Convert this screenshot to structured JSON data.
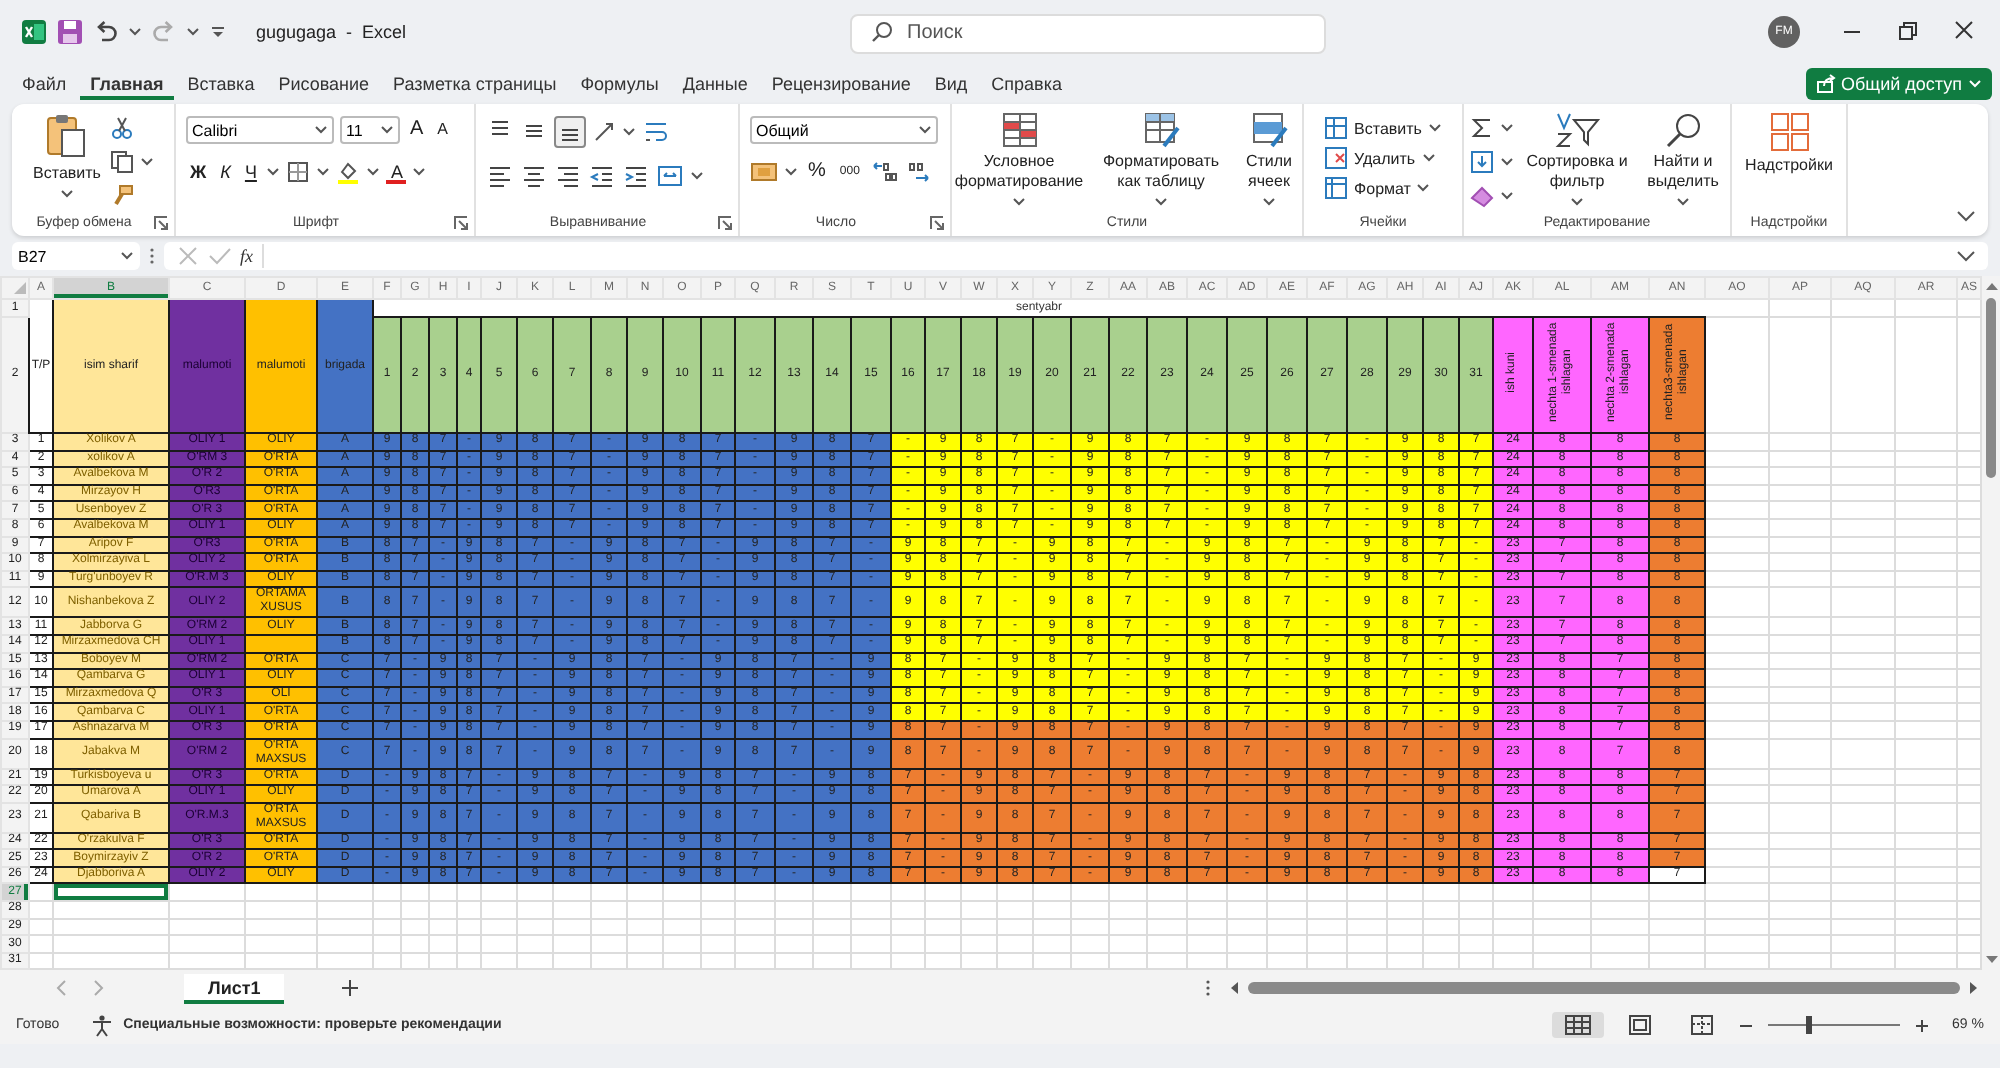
{
  "title_bar": {
    "title": "gugugaga  -  Excel",
    "search_placeholder": "Поиск",
    "avatar": "FM"
  },
  "menu_tabs": [
    {
      "label": "Файл",
      "selected": false
    },
    {
      "label": "Главная",
      "selected": true
    },
    {
      "label": "Вставка",
      "selected": false
    },
    {
      "label": "Рисование",
      "selected": false
    },
    {
      "label": "Разметка страницы",
      "selected": false
    },
    {
      "label": "Формулы",
      "selected": false
    },
    {
      "label": "Данные",
      "selected": false
    },
    {
      "label": "Рецензирование",
      "selected": false
    },
    {
      "label": "Вид",
      "selected": false
    },
    {
      "label": "Справка",
      "selected": false
    }
  ],
  "share_button": "Общий доступ",
  "ribbon": [
    {
      "kind": "clipboard",
      "label": "Буфер обмена",
      "paste": "Вставить",
      "launcher": true
    },
    {
      "kind": "font",
      "label": "Шрифт",
      "font": "Calibri",
      "size": "11",
      "grow": "A",
      "shrink": "A",
      "bold": "Ж",
      "italic": "К",
      "underline": "Ч",
      "font_color": "A",
      "launcher": true
    },
    {
      "kind": "alignment",
      "label": "Выравнивание",
      "vertical_align": [
        {
          "selected": false
        },
        {
          "selected": false
        },
        {
          "selected": true
        }
      ],
      "launcher": true
    },
    {
      "kind": "number",
      "label": "Число",
      "format": "Общий",
      "percent": "%",
      "thousands": "000",
      "launcher": true
    },
    {
      "kind": "styles",
      "label": "Стили",
      "buttons": [
        "Условное форматирование",
        "Форматировать как таблицу",
        "Стили ячеек"
      ],
      "launcher": false
    },
    {
      "kind": "cells",
      "label": "Ячейки",
      "buttons": [
        "Вставить",
        "Удалить",
        "Формат"
      ],
      "launcher": false
    },
    {
      "kind": "editing",
      "label": "Редактирование",
      "buttons": [
        "Сортировка и фильтр",
        "Найти и выделить"
      ],
      "launcher": false
    },
    {
      "kind": "addins",
      "label": "Надстройки",
      "buttons": [
        "Надстройки"
      ],
      "launcher": false
    }
  ],
  "formula_bar": {
    "name_box": "B27",
    "function_label": "fx"
  },
  "columns": [
    {
      "label": "A",
      "selected": false
    },
    {
      "label": "B",
      "selected": true
    },
    {
      "label": "C",
      "selected": false
    },
    {
      "label": "D",
      "selected": false
    },
    {
      "label": "E",
      "selected": false
    },
    {
      "label": "F",
      "selected": false
    },
    {
      "label": "G",
      "selected": false
    },
    {
      "label": "H",
      "selected": false
    },
    {
      "label": "I",
      "selected": false
    },
    {
      "label": "J",
      "selected": false
    },
    {
      "label": "K",
      "selected": false
    },
    {
      "label": "L",
      "selected": false
    },
    {
      "label": "M",
      "selected": false
    },
    {
      "label": "N",
      "selected": false
    },
    {
      "label": "O",
      "selected": false
    },
    {
      "label": "P",
      "selected": false
    },
    {
      "label": "Q",
      "selected": false
    },
    {
      "label": "R",
      "selected": false
    },
    {
      "label": "S",
      "selected": false
    },
    {
      "label": "T",
      "selected": false
    },
    {
      "label": "U",
      "selected": false
    },
    {
      "label": "V",
      "selected": false
    },
    {
      "label": "W",
      "selected": false
    },
    {
      "label": "X",
      "selected": false
    },
    {
      "label": "Y",
      "selected": false
    },
    {
      "label": "Z",
      "selected": false
    },
    {
      "label": "AA",
      "selected": false
    },
    {
      "label": "AB",
      "selected": false
    },
    {
      "label": "AC",
      "selected": false
    },
    {
      "label": "AD",
      "selected": false
    },
    {
      "label": "AE",
      "selected": false
    },
    {
      "label": "AF",
      "selected": false
    },
    {
      "label": "AG",
      "selected": false
    },
    {
      "label": "AH",
      "selected": false
    },
    {
      "label": "AI",
      "selected": false
    },
    {
      "label": "AJ",
      "selected": false
    },
    {
      "label": "AK",
      "selected": false
    },
    {
      "label": "AL",
      "selected": false
    },
    {
      "label": "AM",
      "selected": false
    },
    {
      "label": "AN",
      "selected": false
    },
    {
      "label": "AO",
      "selected": false
    },
    {
      "label": "AP",
      "selected": false
    },
    {
      "label": "AQ",
      "selected": false
    },
    {
      "label": "AR",
      "selected": false
    },
    {
      "label": "AS",
      "selected": false
    }
  ],
  "row_headers": [
    {
      "label": "1",
      "selected": false
    },
    {
      "label": "2",
      "selected": false
    },
    {
      "label": "3",
      "selected": false
    },
    {
      "label": "4",
      "selected": false
    },
    {
      "label": "5",
      "selected": false
    },
    {
      "label": "6",
      "selected": false
    },
    {
      "label": "7",
      "selected": false
    },
    {
      "label": "8",
      "selected": false
    },
    {
      "label": "9",
      "selected": false
    },
    {
      "label": "10",
      "selected": false
    },
    {
      "label": "11",
      "selected": false
    },
    {
      "label": "12",
      "selected": false
    },
    {
      "label": "13",
      "selected": false
    },
    {
      "label": "14",
      "selected": false
    },
    {
      "label": "15",
      "selected": false
    },
    {
      "label": "16",
      "selected": false
    },
    {
      "label": "17",
      "selected": false
    },
    {
      "label": "18",
      "selected": false
    },
    {
      "label": "19",
      "selected": false
    },
    {
      "label": "20",
      "selected": false
    },
    {
      "label": "21",
      "selected": false
    },
    {
      "label": "22",
      "selected": false
    },
    {
      "label": "23",
      "selected": false
    },
    {
      "label": "24",
      "selected": false
    },
    {
      "label": "25",
      "selected": false
    },
    {
      "label": "26",
      "selected": false
    },
    {
      "label": "27",
      "selected": true
    },
    {
      "label": "28",
      "selected": false
    },
    {
      "label": "29",
      "selected": false
    },
    {
      "label": "30",
      "selected": false
    },
    {
      "label": "31",
      "selected": false
    }
  ],
  "header": {
    "columns": [
      {
        "text": "T/P",
        "color": "#ffffff"
      },
      {
        "text": "isim sharif",
        "color": "#ffe699"
      },
      {
        "text": "malumoti",
        "color": "#7030a0"
      },
      {
        "text": "malumoti",
        "color": "#ffc000"
      },
      {
        "text": "brigada",
        "color": "#4472c4"
      }
    ],
    "month": "sentyabr",
    "days": [
      "1",
      "2",
      "3",
      "4",
      "5",
      "6",
      "7",
      "8",
      "9",
      "10",
      "11",
      "12",
      "13",
      "14",
      "15",
      "16",
      "17",
      "18",
      "19",
      "20",
      "21",
      "22",
      "23",
      "24",
      "25",
      "26",
      "27",
      "28",
      "29",
      "30",
      "31"
    ],
    "summary": [
      {
        "text": "ish kuni",
        "color": "#ff66ff"
      },
      {
        "text": "nechta 1-smenada ishlagan",
        "color": "#ff66ff"
      },
      {
        "text": "nechta 2-smenada ishlagan",
        "color": "#ff66ff"
      },
      {
        "text": "nechta3-smenada ishlagan",
        "color": "#ed7d31"
      }
    ]
  },
  "rows": [
    {
      "tp": "1",
      "name": "Xolikov A",
      "education_1": "OLIY 1",
      "education_2": "OLIY",
      "brigada": "A",
      "color": "#ffff00",
      "totals": [
        "24",
        "8",
        "8"
      ],
      "last_total": {
        "text": "8",
        "color": "#ed7d31"
      },
      "days": [
        "9",
        "8",
        "7",
        "-",
        "9",
        "8",
        "7",
        "-",
        "9",
        "8",
        "7",
        "-",
        "9",
        "8",
        "7",
        "-",
        "9",
        "8",
        "7",
        "-",
        "9",
        "8",
        "7",
        "-",
        "9",
        "8",
        "7",
        "-",
        "9",
        "8",
        "7"
      ]
    },
    {
      "tp": "2",
      "name": "xolikov A",
      "education_1": "O'RM 3",
      "education_2": "O'RTA",
      "brigada": "A",
      "color": "#ffff00",
      "totals": [
        "24",
        "8",
        "8"
      ],
      "last_total": {
        "text": "8",
        "color": "#ed7d31"
      },
      "days": [
        "9",
        "8",
        "7",
        "-",
        "9",
        "8",
        "7",
        "-",
        "9",
        "8",
        "7",
        "-",
        "9",
        "8",
        "7",
        "-",
        "9",
        "8",
        "7",
        "-",
        "9",
        "8",
        "7",
        "-",
        "9",
        "8",
        "7",
        "-",
        "9",
        "8",
        "7"
      ]
    },
    {
      "tp": "3",
      "name": "Avalbekova M",
      "education_1": "O'R 2",
      "education_2": "O'RTA",
      "brigada": "A",
      "color": "#ffff00",
      "totals": [
        "24",
        "8",
        "8"
      ],
      "last_total": {
        "text": "8",
        "color": "#ed7d31"
      },
      "days": [
        "9",
        "8",
        "7",
        "-",
        "9",
        "8",
        "7",
        "-",
        "9",
        "8",
        "7",
        "-",
        "9",
        "8",
        "7",
        "-",
        "9",
        "8",
        "7",
        "-",
        "9",
        "8",
        "7",
        "-",
        "9",
        "8",
        "7",
        "-",
        "9",
        "8",
        "7"
      ]
    },
    {
      "tp": "4",
      "name": "Mirzayov H",
      "education_1": "O'R3",
      "education_2": "O'RTA",
      "brigada": "A",
      "color": "#ffff00",
      "totals": [
        "24",
        "8",
        "8"
      ],
      "last_total": {
        "text": "8",
        "color": "#ed7d31"
      },
      "days": [
        "9",
        "8",
        "7",
        "-",
        "9",
        "8",
        "7",
        "-",
        "9",
        "8",
        "7",
        "-",
        "9",
        "8",
        "7",
        "-",
        "9",
        "8",
        "7",
        "-",
        "9",
        "8",
        "7",
        "-",
        "9",
        "8",
        "7",
        "-",
        "9",
        "8",
        "7"
      ]
    },
    {
      "tp": "5",
      "name": "Usenboyev Z",
      "education_1": "O'R 3",
      "education_2": "O'RTA",
      "brigada": "A",
      "color": "#ffff00",
      "totals": [
        "24",
        "8",
        "8"
      ],
      "last_total": {
        "text": "8",
        "color": "#ed7d31"
      },
      "days": [
        "9",
        "8",
        "7",
        "-",
        "9",
        "8",
        "7",
        "-",
        "9",
        "8",
        "7",
        "-",
        "9",
        "8",
        "7",
        "-",
        "9",
        "8",
        "7",
        "-",
        "9",
        "8",
        "7",
        "-",
        "9",
        "8",
        "7",
        "-",
        "9",
        "8",
        "7"
      ]
    },
    {
      "tp": "6",
      "name": "Avalbekova M",
      "education_1": "OLIY 1",
      "education_2": "OLIY",
      "brigada": "A",
      "color": "#ffff00",
      "totals": [
        "24",
        "8",
        "8"
      ],
      "last_total": {
        "text": "8",
        "color": "#ed7d31"
      },
      "days": [
        "9",
        "8",
        "7",
        "-",
        "9",
        "8",
        "7",
        "-",
        "9",
        "8",
        "7",
        "-",
        "9",
        "8",
        "7",
        "-",
        "9",
        "8",
        "7",
        "-",
        "9",
        "8",
        "7",
        "-",
        "9",
        "8",
        "7",
        "-",
        "9",
        "8",
        "7"
      ]
    },
    {
      "tp": "7",
      "name": "Aripov F",
      "education_1": "O'R3",
      "education_2": "O'RTA",
      "brigada": "B",
      "color": "#ffff00",
      "totals": [
        "23",
        "7",
        "8"
      ],
      "last_total": {
        "text": "8",
        "color": "#ed7d31"
      },
      "days": [
        "8",
        "7",
        "-",
        "9",
        "8",
        "7",
        "-",
        "9",
        "8",
        "7",
        "-",
        "9",
        "8",
        "7",
        "-",
        "9",
        "8",
        "7",
        "-",
        "9",
        "8",
        "7",
        "-",
        "9",
        "8",
        "7",
        "-",
        "9",
        "8",
        "7",
        "-"
      ]
    },
    {
      "tp": "8",
      "name": "Xolmirzayiva L",
      "education_1": "OLIY 2",
      "education_2": "O'RTA",
      "brigada": "B",
      "color": "#ffff00",
      "totals": [
        "23",
        "7",
        "8"
      ],
      "last_total": {
        "text": "8",
        "color": "#ed7d31"
      },
      "days": [
        "8",
        "7",
        "-",
        "9",
        "8",
        "7",
        "-",
        "9",
        "8",
        "7",
        "-",
        "9",
        "8",
        "7",
        "-",
        "9",
        "8",
        "7",
        "-",
        "9",
        "8",
        "7",
        "-",
        "9",
        "8",
        "7",
        "-",
        "9",
        "8",
        "7",
        "-"
      ]
    },
    {
      "tp": "9",
      "name": "Turg'unboyev R",
      "education_1": "O'R.M 3",
      "education_2": "OLIY",
      "brigada": "B",
      "color": "#ffff00",
      "totals": [
        "23",
        "7",
        "8"
      ],
      "last_total": {
        "text": "8",
        "color": "#ed7d31"
      },
      "days": [
        "8",
        "7",
        "-",
        "9",
        "8",
        "7",
        "-",
        "9",
        "8",
        "7",
        "-",
        "9",
        "8",
        "7",
        "-",
        "9",
        "8",
        "7",
        "-",
        "9",
        "8",
        "7",
        "-",
        "9",
        "8",
        "7",
        "-",
        "9",
        "8",
        "7",
        "-"
      ]
    },
    {
      "tp": "10",
      "name": "Nishanbekova Z",
      "education_1": "OLIY 2",
      "education_2": "ORTAMA XUSUS",
      "brigada": "B",
      "color": "#ffff00",
      "totals": [
        "23",
        "7",
        "8"
      ],
      "last_total": {
        "text": "8",
        "color": "#ed7d31"
      },
      "days": [
        "8",
        "7",
        "-",
        "9",
        "8",
        "7",
        "-",
        "9",
        "8",
        "7",
        "-",
        "9",
        "8",
        "7",
        "-",
        "9",
        "8",
        "7",
        "-",
        "9",
        "8",
        "7",
        "-",
        "9",
        "8",
        "7",
        "-",
        "9",
        "8",
        "7",
        "-"
      ]
    },
    {
      "tp": "11",
      "name": "Jabborva G",
      "education_1": "O'RM 2",
      "education_2": "OLIY",
      "brigada": "B",
      "color": "#ffff00",
      "totals": [
        "23",
        "7",
        "8"
      ],
      "last_total": {
        "text": "8",
        "color": "#ed7d31"
      },
      "days": [
        "8",
        "7",
        "-",
        "9",
        "8",
        "7",
        "-",
        "9",
        "8",
        "7",
        "-",
        "9",
        "8",
        "7",
        "-",
        "9",
        "8",
        "7",
        "-",
        "9",
        "8",
        "7",
        "-",
        "9",
        "8",
        "7",
        "-",
        "9",
        "8",
        "7",
        "-"
      ]
    },
    {
      "tp": "12",
      "name": "Mirzaxmedova CH",
      "education_1": "OLIY 1",
      "brigada": "B",
      "color": "#ffff00",
      "totals": [
        "23",
        "7",
        "8"
      ],
      "last_total": {
        "text": "8",
        "color": "#ed7d31"
      },
      "days": [
        "8",
        "7",
        "-",
        "9",
        "8",
        "7",
        "-",
        "9",
        "8",
        "7",
        "-",
        "9",
        "8",
        "7",
        "-",
        "9",
        "8",
        "7",
        "-",
        "9",
        "8",
        "7",
        "-",
        "9",
        "8",
        "7",
        "-",
        "9",
        "8",
        "7",
        "-"
      ]
    },
    {
      "tp": "13",
      "name": "Boboyev M",
      "education_1": "O'RM 2",
      "education_2": "O'RTA",
      "brigada": "C",
      "color": "#ffff00",
      "totals": [
        "23",
        "8",
        "7"
      ],
      "last_total": {
        "text": "8",
        "color": "#ed7d31"
      },
      "days": [
        "7",
        "-",
        "9",
        "8",
        "7",
        "-",
        "9",
        "8",
        "7",
        "-",
        "9",
        "8",
        "7",
        "-",
        "9",
        "8",
        "7",
        "-",
        "9",
        "8",
        "7",
        "-",
        "9",
        "8",
        "7",
        "-",
        "9",
        "8",
        "7",
        "-",
        "9"
      ]
    },
    {
      "tp": "14",
      "name": "Qambarva G",
      "education_1": "OLIY 1",
      "education_2": "OLIY",
      "brigada": "C",
      "color": "#ffff00",
      "totals": [
        "23",
        "8",
        "7"
      ],
      "last_total": {
        "text": "8",
        "color": "#ed7d31"
      },
      "days": [
        "7",
        "-",
        "9",
        "8",
        "7",
        "-",
        "9",
        "8",
        "7",
        "-",
        "9",
        "8",
        "7",
        "-",
        "9",
        "8",
        "7",
        "-",
        "9",
        "8",
        "7",
        "-",
        "9",
        "8",
        "7",
        "-",
        "9",
        "8",
        "7",
        "-",
        "9"
      ]
    },
    {
      "tp": "15",
      "name": "Mirzaxmedova Q",
      "education_1": "O'R 3",
      "education_2": "OLI",
      "brigada": "C",
      "color": "#ffff00",
      "totals": [
        "23",
        "8",
        "7"
      ],
      "last_total": {
        "text": "8",
        "color": "#ed7d31"
      },
      "days": [
        "7",
        "-",
        "9",
        "8",
        "7",
        "-",
        "9",
        "8",
        "7",
        "-",
        "9",
        "8",
        "7",
        "-",
        "9",
        "8",
        "7",
        "-",
        "9",
        "8",
        "7",
        "-",
        "9",
        "8",
        "7",
        "-",
        "9",
        "8",
        "7",
        "-",
        "9"
      ]
    },
    {
      "tp": "16",
      "name": "Qambarva C",
      "education_1": "OLIY 1",
      "education_2": "O'RTA",
      "brigada": "C",
      "color": "#ffff00",
      "totals": [
        "23",
        "8",
        "7"
      ],
      "last_total": {
        "text": "8",
        "color": "#ed7d31"
      },
      "days": [
        "7",
        "-",
        "9",
        "8",
        "7",
        "-",
        "9",
        "8",
        "7",
        "-",
        "9",
        "8",
        "7",
        "-",
        "9",
        "8",
        "7",
        "-",
        "9",
        "8",
        "7",
        "-",
        "9",
        "8",
        "7",
        "-",
        "9",
        "8",
        "7",
        "-",
        "9"
      ]
    },
    {
      "tp": "17",
      "name": "Ashnazarva M",
      "education_1": "O'R 3",
      "education_2": "O'RTA",
      "brigada": "C",
      "color": "#ed7d31",
      "totals": [
        "23",
        "8",
        "7"
      ],
      "last_total": {
        "text": "8",
        "color": "#ed7d31"
      },
      "days": [
        "7",
        "-",
        "9",
        "8",
        "7",
        "-",
        "9",
        "8",
        "7",
        "-",
        "9",
        "8",
        "7",
        "-",
        "9",
        "8",
        "7",
        "-",
        "9",
        "8",
        "7",
        "-",
        "9",
        "8",
        "7",
        "-",
        "9",
        "8",
        "7",
        "-",
        "9"
      ]
    },
    {
      "tp": "18",
      "name": "Jabakva M",
      "education_1": "O'RM 2",
      "education_2": "O'RTA MAXSUS",
      "brigada": "C",
      "color": "#ed7d31",
      "totals": [
        "23",
        "8",
        "7"
      ],
      "last_total": {
        "text": "8",
        "color": "#ed7d31"
      },
      "days": [
        "7",
        "-",
        "9",
        "8",
        "7",
        "-",
        "9",
        "8",
        "7",
        "-",
        "9",
        "8",
        "7",
        "-",
        "9",
        "8",
        "7",
        "-",
        "9",
        "8",
        "7",
        "-",
        "9",
        "8",
        "7",
        "-",
        "9",
        "8",
        "7",
        "-",
        "9"
      ]
    },
    {
      "tp": "19",
      "name": "Turkisboyeva u",
      "education_1": "O'R 3",
      "education_2": "O'RTA",
      "brigada": "D",
      "color": "#ed7d31",
      "totals": [
        "23",
        "8",
        "8"
      ],
      "last_total": {
        "text": "7",
        "color": "#ed7d31"
      },
      "days": [
        "-",
        "9",
        "8",
        "7",
        "-",
        "9",
        "8",
        "7",
        "-",
        "9",
        "8",
        "7",
        "-",
        "9",
        "8",
        "7",
        "-",
        "9",
        "8",
        "7",
        "-",
        "9",
        "8",
        "7",
        "-",
        "9",
        "8",
        "7",
        "-",
        "9",
        "8"
      ]
    },
    {
      "tp": "20",
      "name": "Umarova A",
      "education_1": "OLIY 1",
      "education_2": "OLIY",
      "brigada": "D",
      "color": "#ed7d31",
      "totals": [
        "23",
        "8",
        "8"
      ],
      "last_total": {
        "text": "7",
        "color": "#ed7d31"
      },
      "days": [
        "-",
        "9",
        "8",
        "7",
        "-",
        "9",
        "8",
        "7",
        "-",
        "9",
        "8",
        "7",
        "-",
        "9",
        "8",
        "7",
        "-",
        "9",
        "8",
        "7",
        "-",
        "9",
        "8",
        "7",
        "-",
        "9",
        "8",
        "7",
        "-",
        "9",
        "8"
      ]
    },
    {
      "tp": "21",
      "name": "Qabariva B",
      "education_1": "O'R.M.3",
      "education_2": "O'RTA MAXSUS",
      "brigada": "D",
      "color": "#ed7d31",
      "totals": [
        "23",
        "8",
        "8"
      ],
      "last_total": {
        "text": "7",
        "color": "#ed7d31"
      },
      "days": [
        "-",
        "9",
        "8",
        "7",
        "-",
        "9",
        "8",
        "7",
        "-",
        "9",
        "8",
        "7",
        "-",
        "9",
        "8",
        "7",
        "-",
        "9",
        "8",
        "7",
        "-",
        "9",
        "8",
        "7",
        "-",
        "9",
        "8",
        "7",
        "-",
        "9",
        "8"
      ]
    },
    {
      "tp": "22",
      "name": "O'rzakulva F",
      "education_1": "O'R 3",
      "education_2": "O'RTA",
      "brigada": "D",
      "color": "#ed7d31",
      "totals": [
        "23",
        "8",
        "8"
      ],
      "last_total": {
        "text": "7",
        "color": "#ed7d31"
      },
      "days": [
        "-",
        "9",
        "8",
        "7",
        "-",
        "9",
        "8",
        "7",
        "-",
        "9",
        "8",
        "7",
        "-",
        "9",
        "8",
        "7",
        "-",
        "9",
        "8",
        "7",
        "-",
        "9",
        "8",
        "7",
        "-",
        "9",
        "8",
        "7",
        "-",
        "9",
        "8"
      ]
    },
    {
      "tp": "23",
      "name": "Boymirzayiv Z",
      "education_1": "O'R 2",
      "education_2": "O'RTA",
      "brigada": "D",
      "color": "#ed7d31",
      "totals": [
        "23",
        "8",
        "8"
      ],
      "last_total": {
        "text": "7",
        "color": "#ed7d31"
      },
      "days": [
        "-",
        "9",
        "8",
        "7",
        "-",
        "9",
        "8",
        "7",
        "-",
        "9",
        "8",
        "7",
        "-",
        "9",
        "8",
        "7",
        "-",
        "9",
        "8",
        "7",
        "-",
        "9",
        "8",
        "7",
        "-",
        "9",
        "8",
        "7",
        "-",
        "9",
        "8"
      ]
    },
    {
      "tp": "24",
      "name": "Djabboriva A",
      "education_1": "OLIY 2",
      "education_2": "OLIY",
      "brigada": "D",
      "color": "#ed7d31",
      "totals": [
        "23",
        "8",
        "8"
      ],
      "last_total": {
        "text": "7",
        "color": "#ffffff"
      },
      "days": [
        "-",
        "9",
        "8",
        "7",
        "-",
        "9",
        "8",
        "7",
        "-",
        "9",
        "8",
        "7",
        "-",
        "9",
        "8",
        "7",
        "-",
        "9",
        "8",
        "7",
        "-",
        "9",
        "8",
        "7",
        "-",
        "9",
        "8",
        "7",
        "-",
        "9",
        "8"
      ]
    }
  ],
  "sheet_tabs": [
    {
      "label": "Лист1",
      "selected": true
    }
  ],
  "status_bar": {
    "ready": "Готово",
    "accessibility": "Специальные возможности: проверьте рекомендации",
    "views": [
      {
        "kind": "normal",
        "selected": true
      },
      {
        "kind": "layout",
        "selected": false
      },
      {
        "kind": "break",
        "selected": false
      }
    ],
    "zoom_slider": {
      "level": 0.3
    },
    "zoom": "69 %"
  }
}
